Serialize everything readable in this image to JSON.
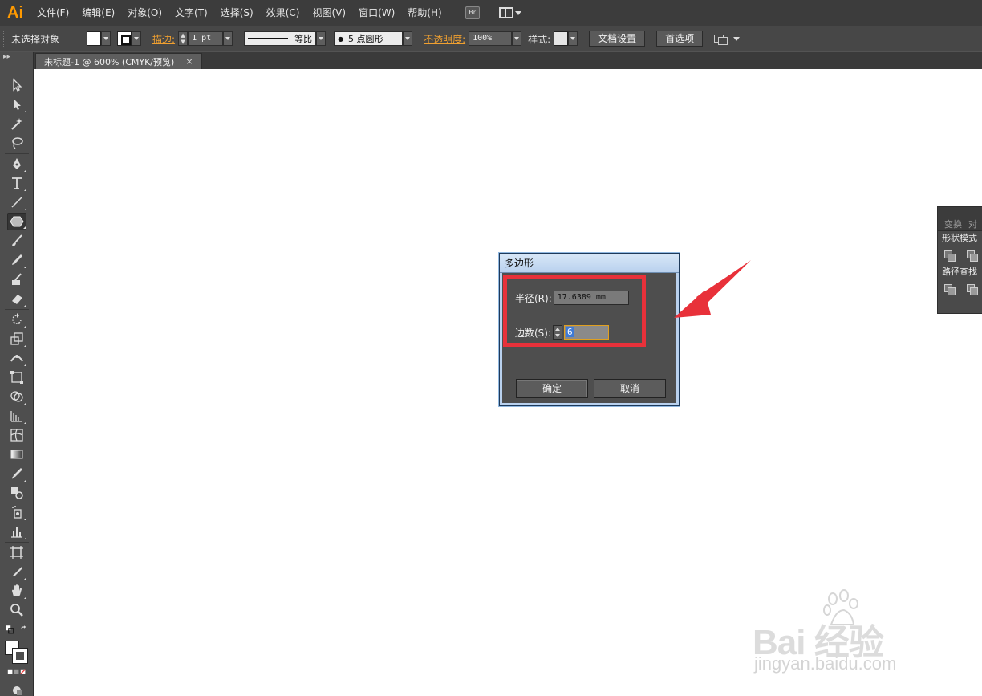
{
  "app": {
    "logo": "Ai",
    "menu": [
      "文件(F)",
      "编辑(E)",
      "对象(O)",
      "文字(T)",
      "选择(S)",
      "效果(C)",
      "视图(V)",
      "窗口(W)",
      "帮助(H)"
    ],
    "bridge_label": "Br"
  },
  "control_bar": {
    "selection_status": "未选择对象",
    "stroke_label": "描边:",
    "stroke_weight": "1 pt",
    "line_profile": "等比",
    "brush": "5 点圆形",
    "brush_bullet": "●",
    "opacity_label": "不透明度:",
    "opacity_value": "100%",
    "style_label": "样式:",
    "doc_setup_button": "文档设置",
    "preferences_button": "首选项"
  },
  "document_tab": {
    "title": "未标题-1 @ 600% (CMYK/预览)",
    "close": "×"
  },
  "toolbar": {
    "header": "▸▸"
  },
  "right_panel": {
    "tabs": [
      "变换",
      "对"
    ],
    "shape_modes": "形状模式",
    "pathfinder": "路径查找"
  },
  "dialog": {
    "title": "多边形",
    "radius_label": "半径(R):",
    "radius_value": "17.6389 mm",
    "sides_label": "边数(S):",
    "sides_value": "6",
    "ok_button": "确定",
    "cancel_button": "取消"
  },
  "watermark": {
    "main": "Bai  经验",
    "url": "jingyan.baidu.com"
  },
  "colors": {
    "accent_orange": "#ff9a00",
    "annotation_red": "#e8313a",
    "selection_blue": "#3d7ad6"
  }
}
